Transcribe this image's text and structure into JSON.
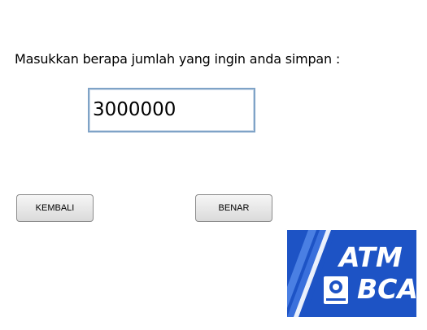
{
  "prompt": "Masukkan berapa jumlah yang ingin anda simpan :",
  "amount_input": {
    "value": "3000000"
  },
  "buttons": {
    "back_label": "KEMBALI",
    "ok_label": "BENAR"
  },
  "logo": {
    "line1": "ATM",
    "line2": "BCA",
    "icon": "bca-logo-icon"
  },
  "colors": {
    "logo_bg": "#1d53c5",
    "field_border": "#7fa3c7"
  }
}
